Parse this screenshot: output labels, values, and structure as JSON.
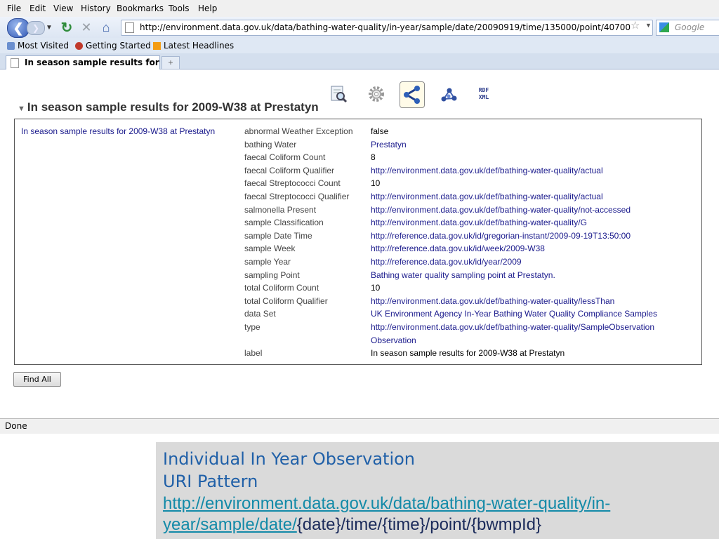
{
  "menubar": {
    "items": [
      "File",
      "Edit",
      "View",
      "History",
      "Bookmarks",
      "Tools",
      "Help"
    ]
  },
  "navbar": {
    "url": "http://environment.data.gov.uk/data/bathing-water-quality/in-year/sample/date/20090919/time/135000/point/40700",
    "search_placeholder": "Google"
  },
  "bookmarks": {
    "items": [
      "Most Visited",
      "Getting Started",
      "Latest Headlines"
    ]
  },
  "tabs": {
    "active_title": "In season sample results for ...",
    "new_tab_label": "+"
  },
  "content": {
    "heading_triangle": "▼",
    "heading": "In season sample results for 2009-W38 at Prestatyn",
    "rdf_icon_text": "RDF XML",
    "subject": "In season sample results for 2009-W38 at Prestatyn",
    "properties": [
      {
        "name": "abnormal Weather Exception",
        "value": "false",
        "link": false
      },
      {
        "name": "bathing Water",
        "value": "Prestatyn",
        "link": true
      },
      {
        "name": "faecal Coliform Count",
        "value": "8",
        "link": false
      },
      {
        "name": "faecal Coliform Qualifier",
        "value": "http://environment.data.gov.uk/def/bathing-water-quality/actual",
        "link": true
      },
      {
        "name": "faecal Streptococci Count",
        "value": "10",
        "link": false
      },
      {
        "name": "faecal Streptococci Qualifier",
        "value": "http://environment.data.gov.uk/def/bathing-water-quality/actual",
        "link": true
      },
      {
        "name": "salmonella Present",
        "value": "http://environment.data.gov.uk/def/bathing-water-quality/not-accessed",
        "link": true
      },
      {
        "name": "sample Classification",
        "value": "http://environment.data.gov.uk/def/bathing-water-quality/G",
        "link": true
      },
      {
        "name": "sample Date Time",
        "value": "http://reference.data.gov.uk/id/gregorian-instant/2009-09-19T13:50:00",
        "link": true
      },
      {
        "name": "sample Week",
        "value": "http://reference.data.gov.uk/id/week/2009-W38",
        "link": true
      },
      {
        "name": "sample Year",
        "value": "http://reference.data.gov.uk/id/year/2009",
        "link": true
      },
      {
        "name": "sampling Point",
        "value": "Bathing water quality sampling point at Prestatyn.",
        "link": true
      },
      {
        "name": "total Coliform Count",
        "value": "10",
        "link": false
      },
      {
        "name": "total Coliform Qualifier",
        "value": "http://environment.data.gov.uk/def/bathing-water-quality/lessThan",
        "link": true
      },
      {
        "name": "data Set",
        "value": "UK Environment Agency In-Year Bathing Water Quality Compliance Samples",
        "link": true
      },
      {
        "name": "type",
        "value": "http://environment.data.gov.uk/def/bathing-water-quality/SampleObservation",
        "value2": "Observation",
        "link": true
      },
      {
        "name": "label",
        "value": "In season sample results for 2009-W38 at Prestatyn",
        "link": false
      }
    ],
    "find_all_label": "Find All"
  },
  "status": {
    "text": "Done"
  },
  "caption": {
    "title": "Individual In Year Observation",
    "subtitle": "URI Pattern",
    "link_part1": "http://environment.data.gov.uk/data/bathing-water-quality/in-",
    "link_part2": "year/sample/date/",
    "pattern_rest": "{date}/time/{time}/point/{bwmpId}"
  }
}
